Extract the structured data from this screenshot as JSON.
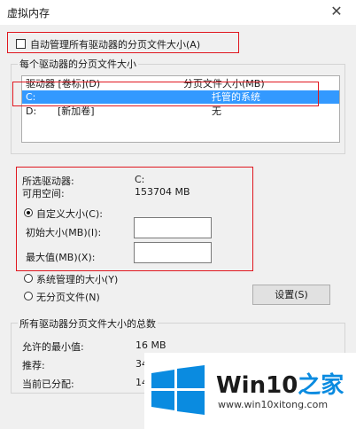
{
  "dialog": {
    "title": "虚拟内存",
    "close_glyph": "✕"
  },
  "auto_manage": {
    "label": "自动管理所有驱动器的分页文件大小(A)",
    "checked": false
  },
  "per_drive": {
    "group_label": "每个驱动器的分页文件大小",
    "columns": {
      "drive": "驱动器 [卷标](D)",
      "paging": "分页文件大小(MB)"
    },
    "rows": [
      {
        "drive": "C:",
        "label": "",
        "paging": "托管的系统",
        "selected": true
      },
      {
        "drive": "D:",
        "label": "[新加卷]",
        "paging": "无",
        "selected": false
      }
    ]
  },
  "selected_drive": {
    "drive_label": "所选驱动器:",
    "drive_value": "C:",
    "space_label": "可用空间:",
    "space_value": "153704 MB"
  },
  "options": {
    "custom_label": "自定义大小(C):",
    "initial_label": "初始大小(MB)(I):",
    "initial_value": "",
    "max_label": "最大值(MB)(X):",
    "max_value": "",
    "system_label": "系统管理的大小(Y)",
    "none_label": "无分页文件(N)",
    "selected": "custom",
    "set_button": "设置(S)"
  },
  "totals": {
    "group_label": "所有驱动器分页文件大小的总数",
    "min_label": "允许的最小值:",
    "min_value": "16 MB",
    "rec_label": "推荐:",
    "rec_value": "34",
    "cur_label": "当前已分配:",
    "cur_value": "14"
  },
  "watermark": {
    "brand_prefix": "Win10",
    "brand_suffix": "之家",
    "url": "www.win10xitong.com"
  },
  "colors": {
    "selection": "#3399ff",
    "highlight_border": "#e0171f",
    "logo_blue": "#0a8be0"
  }
}
